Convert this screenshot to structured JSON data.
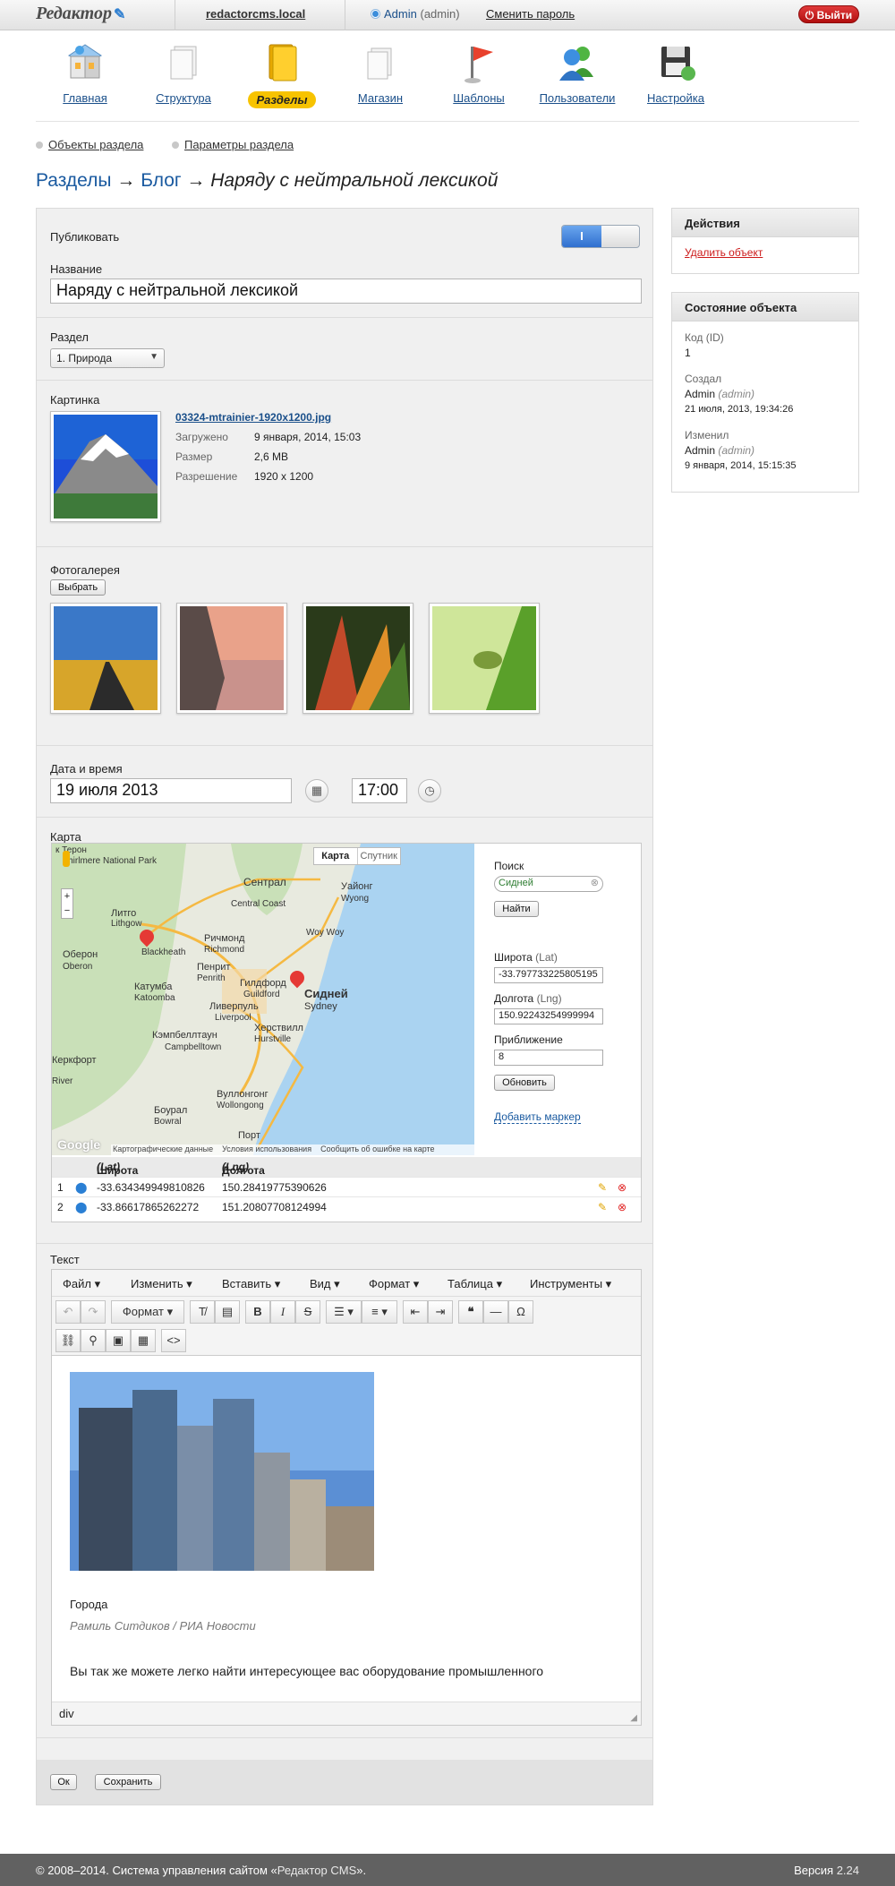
{
  "topbar": {
    "logo": "Редактор",
    "site": "redactorcms.local",
    "user_name": "Admin",
    "user_role": "(admin)",
    "change_password": "Сменить пароль",
    "logout": "Выйти"
  },
  "nav": [
    {
      "label": "Главная",
      "icon": "home-icon"
    },
    {
      "label": "Структура",
      "icon": "documents-icon"
    },
    {
      "label": "Разделы",
      "icon": "folders-icon",
      "active": true
    },
    {
      "label": "Магазин",
      "icon": "shop-icon"
    },
    {
      "label": "Шаблоны",
      "icon": "flag-icon"
    },
    {
      "label": "Пользователи",
      "icon": "users-icon"
    },
    {
      "label": "Настройка",
      "icon": "floppy-settings-icon"
    }
  ],
  "subnav": {
    "objects": "Объекты раздела",
    "params": "Параметры раздела"
  },
  "breadcrumb": {
    "root": "Разделы",
    "blog": "Блог",
    "arrow": "→",
    "current": "Наряду с нейтральной лексикой"
  },
  "form": {
    "publish_label": "Публиковать",
    "publish_on": "I",
    "name_label": "Название",
    "name_value": "Наряду с нейтральной лексикой",
    "section_label": "Раздел",
    "section_value": "1. Природа",
    "image_label": "Картинка",
    "image_file": "03324-mtrainier-1920x1200.jpg",
    "image_meta": {
      "uploaded_k": "Загружено",
      "uploaded_v": "9 января, 2014, 15:03",
      "size_k": "Размер",
      "size_v": "2,6 MB",
      "res_k": "Разрешение",
      "res_v": "1920 x 1200"
    },
    "gallery_label": "Фотогалерея",
    "gallery_btn": "Выбрать",
    "datetime_label": "Дата и время",
    "date_value": "19 июля 2013",
    "time_value": "17:00",
    "map_label": "Карта",
    "map": {
      "tab_map": "Карта",
      "tab_sat": "Спутник",
      "search_label": "Поиск",
      "search_value": "Сидней",
      "find_btn": "Найти",
      "lat_label": "Широта",
      "lat_unit": "(Lat)",
      "lat_value": "-33.797733225805195",
      "lng_label": "Долгота",
      "lng_unit": "(Lng)",
      "lng_value": "150.92243254999994",
      "zoom_label": "Приближение",
      "zoom_value": "8",
      "update_btn": "Обновить",
      "add_marker": "Добавить маркер",
      "attribution": "Картографические данные",
      "terms": "Условия использования",
      "report": "Сообщить об ошибке на карте",
      "google": "Google",
      "labels": {
        "teron": "к Терон",
        "tnp": "Thirlmere National Park",
        "sentral": "Сентрал",
        "central_coast": "Central Coast",
        "woy": "Уайонг",
        "woy_en": "Wyong",
        "litgo": "Литго",
        "lithgow": "Lithgow",
        "richmond": "Ричмонд",
        "richmond_en": "Richmond",
        "woywoy": "Woy Woy",
        "blackheath": "Blackheath",
        "oberon": "Оберон",
        "oberon_en": "Oberon",
        "penrith": "Пенрит",
        "penrith_en": "Penrith",
        "katoomba": "Катумба",
        "katoomba_en": "Katoomba",
        "guildford": "Гилдфорд",
        "guildford_en": "Guildford",
        "sydney": "Сидней",
        "sydney_en": "Sydney",
        "liverpool": "Ливерпуль",
        "liverpool_en": "Liverpool",
        "campbell": "Кэмпбеллтаун",
        "campbell_en": "Campbelltown",
        "hurst": "Херствилл",
        "hurst_en": "Hurstville",
        "bowral": "Боурал",
        "bowral_en": "Bowral",
        "wollongong": "Вуллонгонг",
        "wollongong_en": "Wollongong",
        "port": "Порт",
        "kerk": "Керкфорт",
        "waters": "River"
      }
    },
    "markers_head": {
      "lat": "Широта",
      "lat_u": "(Lat)",
      "lng": "Долгота",
      "lng_u": "(Lng)"
    },
    "markers": [
      {
        "n": "1",
        "lat": "-33.634349949810826",
        "lng": "150.28419775390626"
      },
      {
        "n": "2",
        "lat": "-33.86617865262272",
        "lng": "151.20807708124994"
      }
    ],
    "text_label": "Текст",
    "editor": {
      "menus": [
        "Файл",
        "Изменить",
        "Вставить",
        "Вид",
        "Формат",
        "Таблица",
        "Инструменты"
      ],
      "format_btn": "Формат",
      "caption_title": "Города",
      "caption_author": "Рамиль Ситдиков / РИА Новости",
      "paragraph": "Вы так же можете легко найти интересующее вас оборудование промышленного",
      "status_path": "div"
    },
    "ok_btn": "Ок",
    "save_btn": "Сохранить"
  },
  "sidebar": {
    "actions_title": "Действия",
    "delete": "Удалить объект",
    "state_title": "Состояние объекта",
    "id_k": "Код (ID)",
    "id_v": "1",
    "created_k": "Создал",
    "created_user": "Admin",
    "created_role": "(admin)",
    "created_date": "21 июля, 2013, 19:34:26",
    "modified_k": "Изменил",
    "modified_user": "Admin",
    "modified_role": "(admin)",
    "modified_date": "9 января, 2014, 15:15:35"
  },
  "footer": {
    "copy": "© 2008–2014. Система управления сайтом «",
    "cms": "Редактор CMS",
    "copy_end": "».",
    "version_label": "Версия",
    "version": "2.24"
  }
}
